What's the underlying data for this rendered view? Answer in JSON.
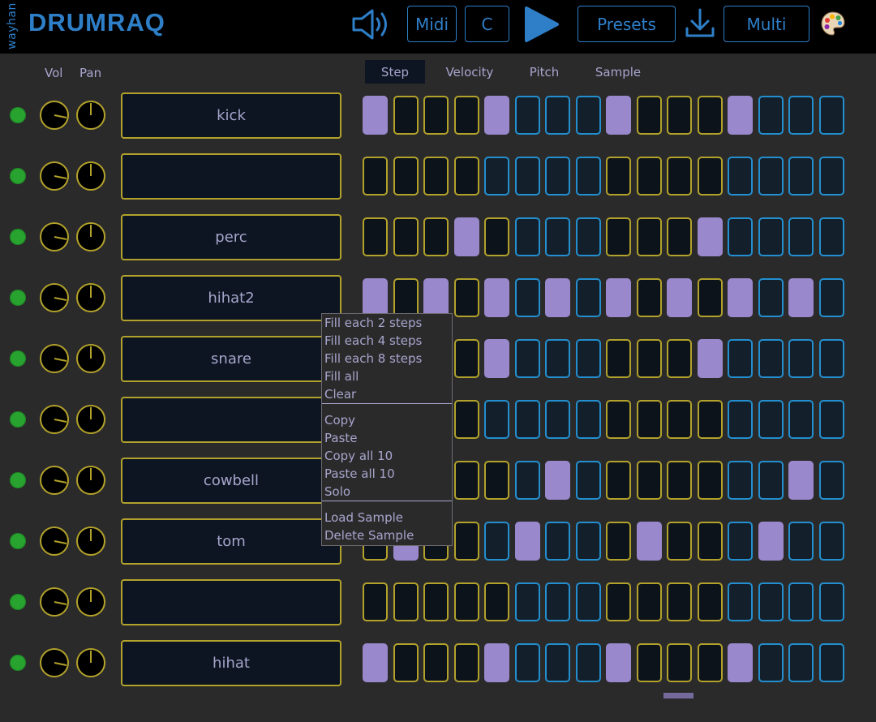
{
  "app": {
    "vendor": "wayhan",
    "name": "DRUMRAQ"
  },
  "toolbar": {
    "midi_label": "Midi",
    "key_label": "C",
    "presets_label": "Presets",
    "mode_label": "Multi"
  },
  "columns": {
    "vol_label": "Vol",
    "pan_label": "Pan"
  },
  "tabs": [
    "Step",
    "Velocity",
    "Pitch",
    "Sample"
  ],
  "active_tab": "Step",
  "tracks": [
    {
      "name": "kick",
      "steps": [
        1,
        0,
        0,
        0,
        1,
        0,
        0,
        0,
        1,
        0,
        0,
        0,
        1,
        0,
        0,
        0
      ]
    },
    {
      "name": "",
      "steps": [
        0,
        0,
        0,
        0,
        0,
        0,
        0,
        0,
        0,
        0,
        0,
        0,
        0,
        0,
        0,
        0
      ]
    },
    {
      "name": "perc",
      "steps": [
        0,
        0,
        0,
        1,
        0,
        0,
        0,
        0,
        0,
        0,
        0,
        1,
        0,
        0,
        0,
        0
      ]
    },
    {
      "name": "hihat2",
      "steps": [
        1,
        0,
        1,
        0,
        1,
        0,
        1,
        0,
        1,
        0,
        1,
        0,
        1,
        0,
        1,
        0
      ]
    },
    {
      "name": "snare",
      "steps": [
        0,
        0,
        0,
        0,
        1,
        0,
        0,
        0,
        0,
        0,
        0,
        1,
        0,
        0,
        0,
        0
      ]
    },
    {
      "name": "",
      "steps": [
        0,
        0,
        0,
        0,
        0,
        0,
        0,
        0,
        0,
        0,
        0,
        0,
        0,
        0,
        0,
        0
      ]
    },
    {
      "name": "cowbell",
      "steps": [
        0,
        0,
        0,
        0,
        0,
        0,
        1,
        0,
        0,
        0,
        0,
        0,
        0,
        0,
        1,
        0
      ]
    },
    {
      "name": "tom",
      "steps": [
        0,
        1,
        0,
        0,
        0,
        1,
        0,
        0,
        0,
        1,
        0,
        0,
        0,
        1,
        0,
        0
      ]
    },
    {
      "name": "",
      "steps": [
        0,
        0,
        0,
        0,
        0,
        0,
        0,
        0,
        0,
        0,
        0,
        0,
        0,
        0,
        0,
        0
      ]
    },
    {
      "name": "hihat",
      "steps": [
        1,
        0,
        0,
        0,
        1,
        0,
        0,
        0,
        1,
        0,
        0,
        0,
        1,
        0,
        0,
        0
      ]
    }
  ],
  "context_menu": {
    "items": [
      "Fill each 2 steps",
      "Fill each 4 steps",
      "Fill each 8 steps",
      "Fill all",
      "Clear",
      "Copy",
      "Paste",
      "Copy all 10",
      "Paste all 10",
      "Solo",
      "Load Sample",
      "Delete Sample"
    ]
  },
  "colors": {
    "accent": "#2e7fc8",
    "knob_ring": "#b2a22b",
    "step_on": "#9a88cc",
    "step_blue_border": "#238fcf",
    "led": "#28a32f",
    "text": "#a7a5cc"
  },
  "icons": {
    "volume": "speaker-icon",
    "play": "play-icon",
    "download": "download-icon",
    "palette": "palette-icon"
  }
}
